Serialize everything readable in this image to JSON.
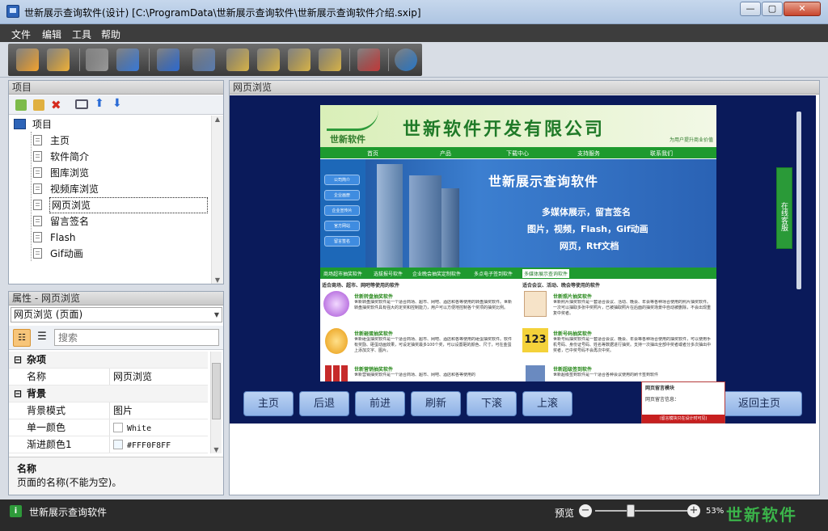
{
  "window": {
    "title": "世新展示查询软件(设计) [C:\\ProgramData\\世新展示查询软件\\世新展示查询软件介绍.sxip]",
    "minimize": "—",
    "maximize": "▢",
    "close": "✕"
  },
  "menu": [
    "文件",
    "编辑",
    "工具",
    "帮助"
  ],
  "toolbar": [
    {
      "name": "new",
      "color": "#f4a531"
    },
    {
      "name": "open",
      "color": "#f0b23a"
    },
    {
      "name": "save",
      "color": "#9a9a9a"
    },
    {
      "name": "preview",
      "color": "#3a7ad8"
    },
    {
      "name": "add-page",
      "color": "#2e6bd0"
    },
    {
      "name": "delete-page",
      "color": "#5a7cb0"
    },
    {
      "name": "cube1",
      "color": "#d8b44a"
    },
    {
      "name": "cube2",
      "color": "#d8b44a"
    },
    {
      "name": "cube3",
      "color": "#d8b44a"
    },
    {
      "name": "cube4",
      "color": "#d8b44a"
    },
    {
      "name": "cart",
      "color": "#c23b3b"
    },
    {
      "name": "globe",
      "color": "#2a79c9"
    }
  ],
  "project": {
    "header": "项目",
    "root": "项目",
    "items": [
      "主页",
      "软件简介",
      "图库浏览",
      "视频库浏览",
      "网页浏览",
      "留言签名",
      "Flash",
      "Gif动画"
    ],
    "selected": "网页浏览"
  },
  "properties": {
    "header": "属性 - 网页浏览",
    "object_select": "网页浏览 (页面)",
    "search_placeholder": "搜索",
    "cat_misc": "杂项",
    "name_key": "名称",
    "name_value": "网页浏览",
    "cat_bg": "背景",
    "bg_mode_key": "背景模式",
    "bg_mode_value": "图片",
    "solid_color_key": "单一颜色",
    "solid_color_value": "White",
    "gradient_key": "渐进颜色1",
    "gradient_value": "#FFF0F8FF",
    "desc_title": "名称",
    "desc_text": "页面的名称(不能为空)。"
  },
  "preview": {
    "header": "网页浏览",
    "company": "世新软件开发有限公司",
    "logo_text": "世新软件",
    "slogan": "为用户提升商业价值",
    "nav": [
      "首页",
      "产品",
      "下载中心",
      "支持服务",
      "联系我们"
    ],
    "banner_title": "世新展示查询软件",
    "banner_sub1": "多媒体展示，留言签名",
    "banner_sub2": "图片，视频，Flash，Gif动画",
    "banner_sub3": "网页，Rtf文档",
    "side_buttons": [
      "公司简介",
      "企业画册",
      "企业宣传片",
      "官方网站",
      "留言签名"
    ],
    "online_service": "在线客服",
    "tabs": [
      "商场超市抽奖软件",
      "选拔报号软件",
      "企业晚会抽奖定制软件",
      "多点电子签到软件",
      "多媒体展示查询软件"
    ],
    "col1_head": "适合商场、超市、网吧等使用的软件",
    "col2_head": "适合会议、活动、晚会等使用的软件",
    "prod1_title": "世新转盘抽奖软件",
    "prod1_text": "世新转盘抽奖软件是一个适合商场、超市、网吧、酒店和各等使用的转盘抽奖软件。世新转盘抽奖软件具有强大的定奖和控制能力，用户可以方便地控制各个奖项的抽奖比例。",
    "prod2_title": "世新砸蛋抽奖软件",
    "prod2_text": "世新砸蛋抽奖软件是一个适合商场、超市、网吧、酒店和各等使用的砸蛋抽奖软件。软件有奖励、砸蛋动画效果，可设定抽奖最多100个奖，可以设置砸的颜色、尺寸，可在金蛋上添加文字、图片。",
    "prod3_title": "世新营销抽奖软件",
    "prod3_text": "世新营销抽奖软件是一个适合商场、超市、网吧、酒店和各等使用的",
    "prod4_title": "世新照片抽奖软件",
    "prod4_text": "世新照片抽奖软件是一套适合会议、活动、晚会、年会等各种场合使用的照片抽奖软件。一次可以抽取多张中奖照片，已被抽取照片在后面的抽奖场景中自动被删除，不会出现重复中奖者。",
    "prod5_title": "世新号码抽奖软件",
    "prod5_text": "世新号码抽奖软件是一套适合会议、晚会、年会等各种场合使用的抽奖软件，可以使用手机号码、身份证号码、姓名等数据进行抽奖。支持一次抽出全部中奖者或者分多次抽出中奖者，已中奖号码不会再次中奖。",
    "prod6_title": "世新超级签到软件",
    "prod6_text": "世新超级签到软件是一个适合各种会议使用的刷卡签到软件",
    "popup_title": "网页留言模块",
    "popup_line": "网页留言信息：",
    "popup_footer": "(留言模块只在设计时可见)",
    "buttons": [
      "主页",
      "后退",
      "前进",
      "刷新",
      "下滚",
      "上滚"
    ],
    "home_button": "返回主页"
  },
  "status": {
    "text": "世新展示查询软件",
    "zoom_label": "预览",
    "zoom_value": "53%",
    "zoom_fraction": 0.53,
    "brand": "世新软件"
  }
}
